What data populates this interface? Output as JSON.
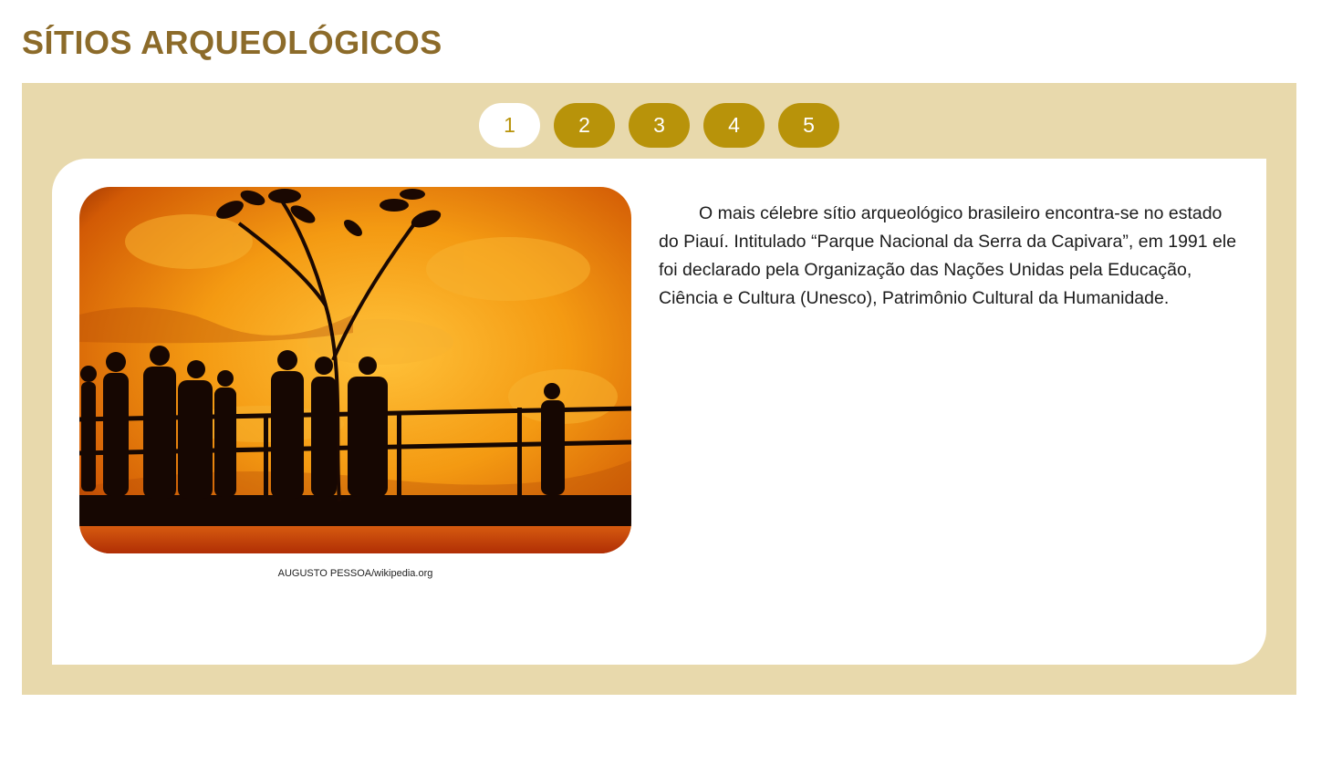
{
  "page": {
    "title": "SÍTIOS ARQUEOLÓGICOS"
  },
  "colors": {
    "title": "#8c6b2a",
    "panel_bg": "#e8d9ac",
    "tab_bg": "#b8930a",
    "tab_active_text": "#b8930a"
  },
  "tabs": [
    {
      "label": "1",
      "active": true
    },
    {
      "label": "2",
      "active": false
    },
    {
      "label": "3",
      "active": false
    },
    {
      "label": "4",
      "active": false
    },
    {
      "label": "5",
      "active": false
    }
  ],
  "content": {
    "image_credit": "AUGUSTO PESSOA/wikipedia.org",
    "paragraph": "O mais célebre sítio arqueológico brasileiro encontra-se no estado do Piauí. Intitulado “Parque Nacional da Serra da Capivara”, em 1991 ele foi declarado pela Organização das Nações Unidas pela Educação, Ciência e Cultura (Unesco), Patrimônio Cultural da Humanidade."
  }
}
